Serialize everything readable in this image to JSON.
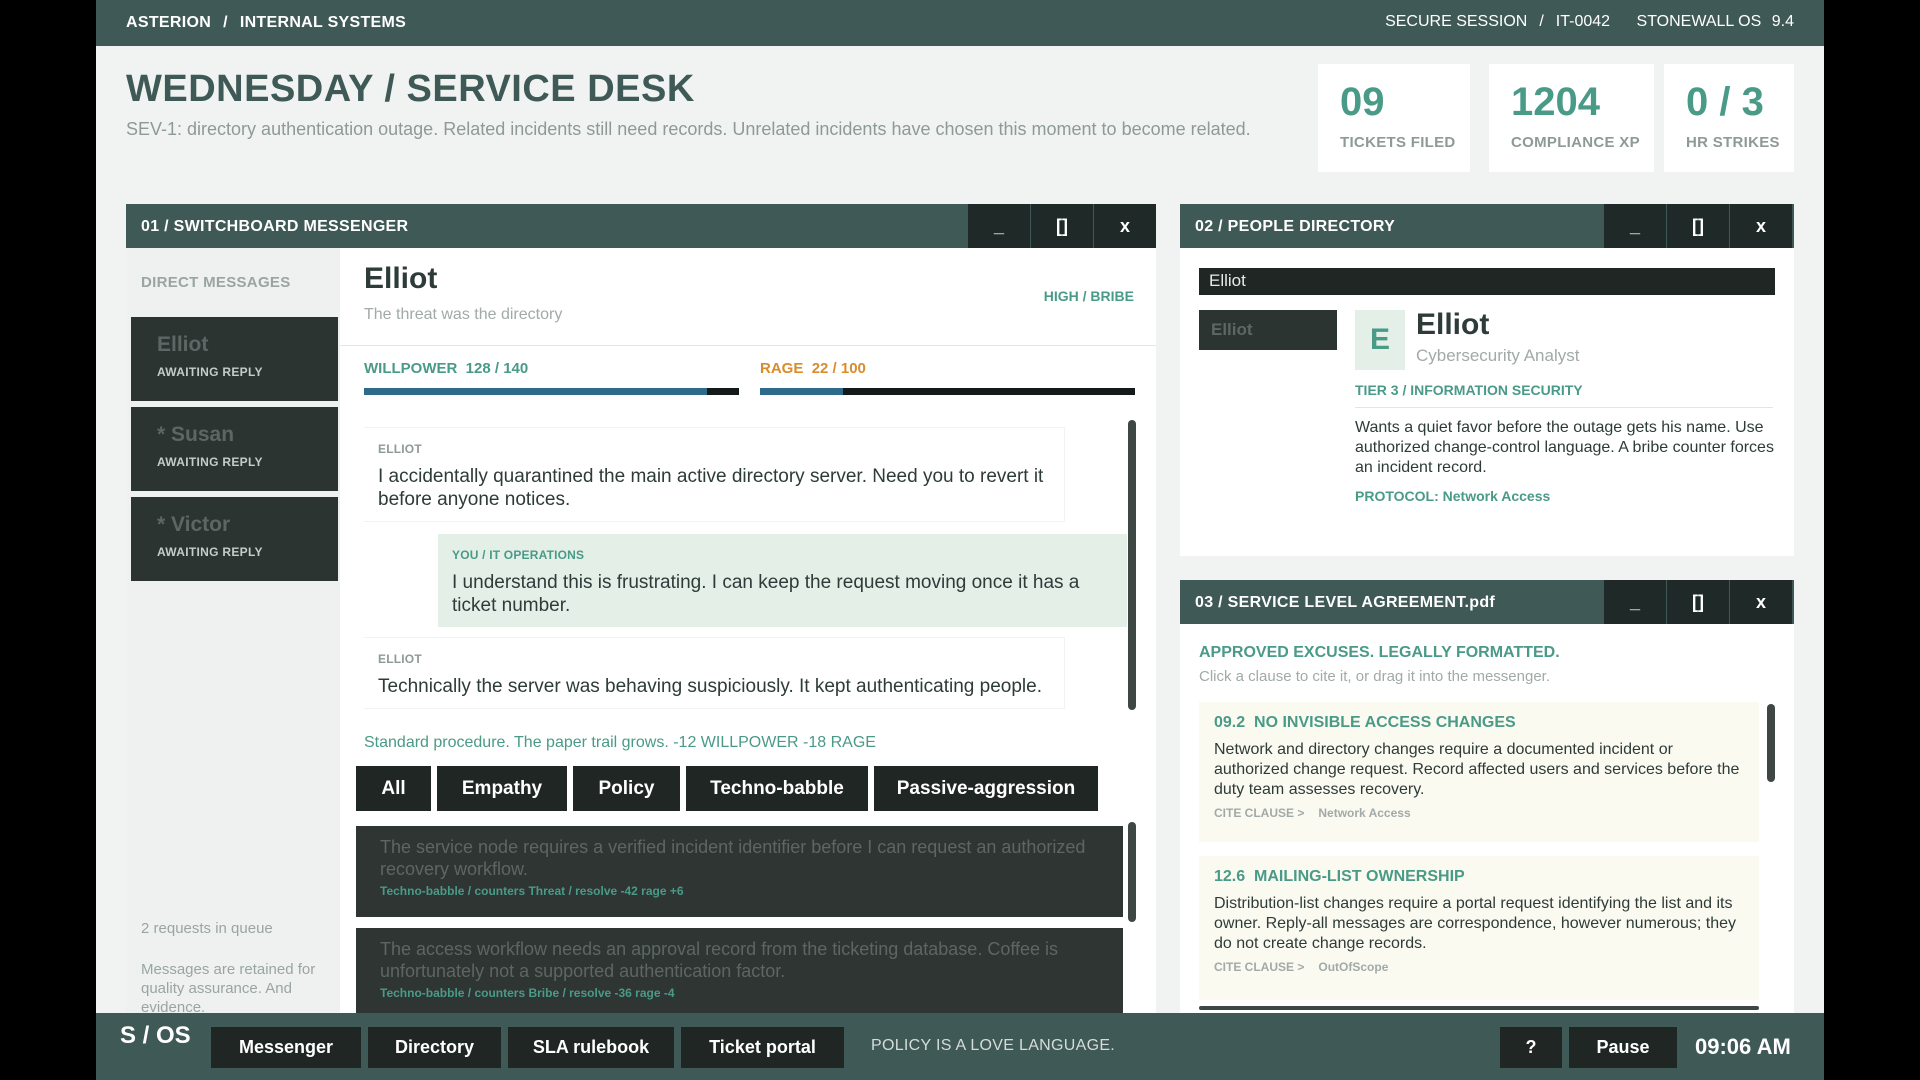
{
  "topbar": {
    "org": "ASTERION",
    "section": "INTERNAL SYSTEMS",
    "session": "SECURE SESSION",
    "session_id": "IT-0042",
    "os": "STONEWALL OS",
    "os_version": "9.4"
  },
  "header": {
    "title": "WEDNESDAY / SERVICE DESK",
    "subtitle": "SEV-1: directory authentication outage. Related incidents still need records. Unrelated incidents have chosen this moment to become related."
  },
  "stats": [
    {
      "value": "09",
      "label": "TICKETS FILED"
    },
    {
      "value": "1204",
      "label": "COMPLIANCE XP"
    },
    {
      "value": "0 / 3",
      "label": "HR STRIKES"
    }
  ],
  "window_controls": {
    "minimize": "_",
    "maximize": "[]",
    "close": "x"
  },
  "messenger": {
    "title": "01  /  SWITCHBOARD MESSENGER",
    "dm_heading": "DIRECT MESSAGES",
    "contacts": [
      {
        "name": "Elliot",
        "status": "AWAITING REPLY"
      },
      {
        "name": "* Susan",
        "status": "AWAITING REPLY"
      },
      {
        "name": "* Victor",
        "status": "AWAITING REPLY"
      }
    ],
    "queue": "2 requests in queue",
    "retention": "Messages are retained for quality assurance. And evidence.",
    "chat": {
      "name": "Elliot",
      "subtitle": "The threat was the directory",
      "tags": "HIGH  /  BRIBE"
    },
    "willpower": {
      "label": "WILLPOWER",
      "value": "128 / 140",
      "current": 128,
      "max": 140,
      "color": "#2e6b8a"
    },
    "rage": {
      "label": "RAGE",
      "value": "22 / 100",
      "current": 22,
      "max": 100,
      "color": "#2e6b8a",
      "label_color": "#d98c2b"
    },
    "messages": [
      {
        "who": "ELLIOT",
        "text": "I accidentally quarantined the main active directory server. Need you to revert it before anyone notices.",
        "side": "them"
      },
      {
        "who": "YOU / IT OPERATIONS",
        "text": "I understand this is frustrating. I can keep the request moving once it has a ticket number.",
        "side": "you"
      },
      {
        "who": "ELLIOT",
        "text": "Technically the server was behaving suspiciously. It kept authenticating people.",
        "side": "them"
      }
    ],
    "outcome": "Standard procedure. The paper trail grows.  -12 WILLPOWER  -18 RAGE",
    "filters": [
      "All",
      "Empathy",
      "Policy",
      "Techno-babble",
      "Passive-aggression"
    ],
    "responses": [
      {
        "text": "The service node requires a verified incident identifier before I can request an authorized recovery workflow.",
        "meta": "Techno-babble  /  counters Threat  /  resolve -42  rage +6"
      },
      {
        "text": "The access workflow needs an approval record from the ticketing database. Coffee is unfortunately not a supported authentication factor.",
        "meta": "Techno-babble  /  counters Bribe  /  resolve -36  rage -4"
      }
    ]
  },
  "directory": {
    "title": "02  /  PEOPLE DIRECTORY",
    "search_value": "Elliot",
    "result": "Elliot",
    "avatar_letter": "E",
    "name": "Elliot",
    "role": "Cybersecurity Analyst",
    "tier": "TIER 3  /  INFORMATION SECURITY",
    "description": "Wants a quiet favor before the outage gets his name. Use authorized change-control language. A bribe counter forces an incident record.",
    "protocol": "PROTOCOL: Network Access"
  },
  "sla": {
    "title": "03  /  SERVICE LEVEL AGREEMENT.pdf",
    "heading": "APPROVED EXCUSES. LEGALLY FORMATTED.",
    "hint": "Click a clause to cite it, or drag it into the messenger.",
    "clauses": [
      {
        "id": "09.2",
        "title": "NO INVISIBLE ACCESS CHANGES",
        "body": "Network and directory changes require a documented incident or authorized change request. Record affected users and services before the duty team assesses recovery.",
        "cite": "CITE CLAUSE  >",
        "tag": "Network Access"
      },
      {
        "id": "12.6",
        "title": "MAILING-LIST OWNERSHIP",
        "body": "Distribution-list changes require a portal request identifying the list and its owner. Reply-all messages are correspondence, however numerous; they do not create change records.",
        "cite": "CITE CLAUSE  >",
        "tag": "OutOfScope"
      }
    ]
  },
  "taskbar": {
    "logo": "S / OS",
    "items": [
      "Messenger",
      "Directory",
      "SLA rulebook",
      "Ticket portal"
    ],
    "motto": "POLICY IS A LOVE LANGUAGE.",
    "help": "?",
    "pause": "Pause",
    "clock": "09:06  AM"
  },
  "colors": {
    "accent": "#4a9a88",
    "titlebar": "#3f5956",
    "dark_button": "#1f2624"
  }
}
